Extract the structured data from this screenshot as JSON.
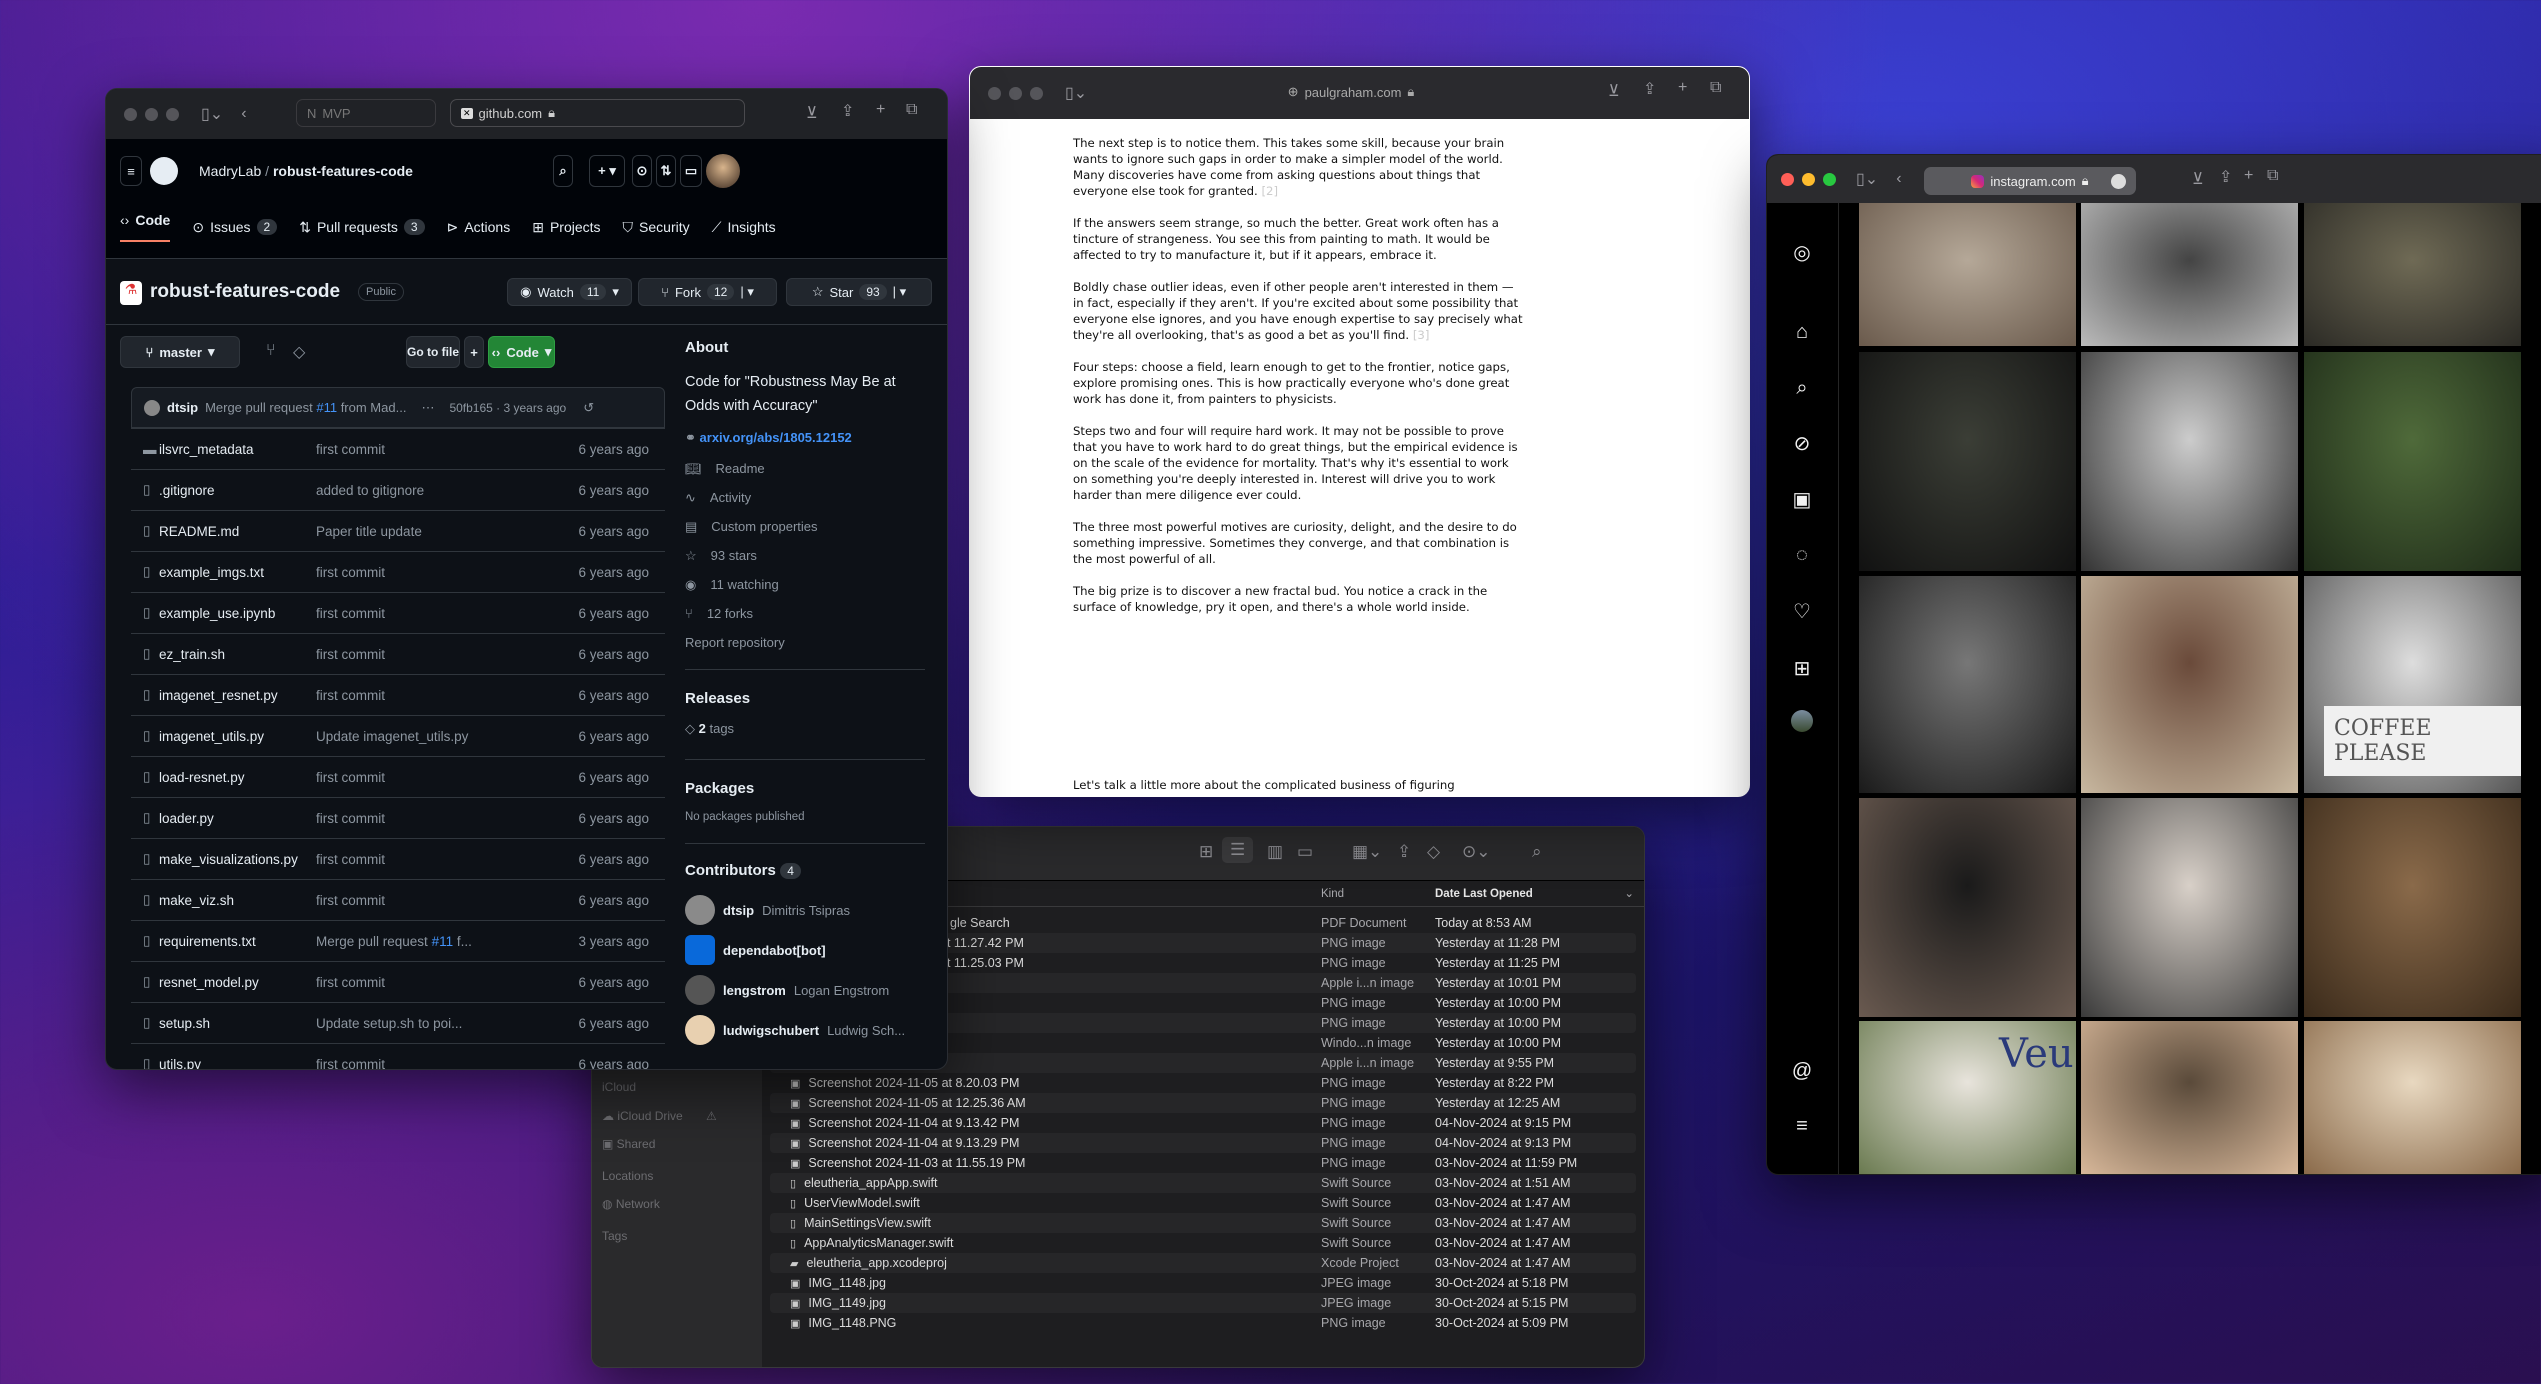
{
  "github_window": {
    "tabs_bar": {
      "pinned_tab": "MVP",
      "url": "github.com"
    },
    "header": {
      "org": "MadryLab",
      "repo": "robust-features-code"
    },
    "nav": [
      {
        "label": "Code"
      },
      {
        "label": "Issues",
        "count": "2"
      },
      {
        "label": "Pull requests",
        "count": "3"
      },
      {
        "label": "Actions"
      },
      {
        "label": "Projects"
      },
      {
        "label": "Security"
      },
      {
        "label": "Insights"
      }
    ],
    "repo_title": "robust-features-code",
    "visibility": "Public",
    "watch": {
      "label": "Watch",
      "count": "11"
    },
    "fork": {
      "label": "Fork",
      "count": "12"
    },
    "star": {
      "label": "Star",
      "count": "93"
    },
    "branch": "master",
    "go_to_file": "Go to file",
    "code_button": "Code",
    "latest_commit": {
      "author": "dtsip",
      "message_pre": "Merge pull request ",
      "pr": "#11",
      "message_post": " from Mad...",
      "sha_time": "50fb165 · 3 years ago"
    },
    "files": [
      {
        "name": "ilsvrc_metadata",
        "type": "folder",
        "message": "first commit",
        "time": "6 years ago"
      },
      {
        "name": ".gitignore",
        "type": "file",
        "message": "added to gitignore",
        "time": "6 years ago"
      },
      {
        "name": "README.md",
        "type": "file",
        "message": "Paper title update",
        "time": "6 years ago"
      },
      {
        "name": "example_imgs.txt",
        "type": "file",
        "message": "first commit",
        "time": "6 years ago"
      },
      {
        "name": "example_use.ipynb",
        "type": "file",
        "message": "first commit",
        "time": "6 years ago"
      },
      {
        "name": "ez_train.sh",
        "type": "file",
        "message": "first commit",
        "time": "6 years ago"
      },
      {
        "name": "imagenet_resnet.py",
        "type": "file",
        "message": "first commit",
        "time": "6 years ago"
      },
      {
        "name": "imagenet_utils.py",
        "type": "file",
        "message": "Update imagenet_utils.py",
        "time": "6 years ago"
      },
      {
        "name": "load-resnet.py",
        "type": "file",
        "message": "first commit",
        "time": "6 years ago"
      },
      {
        "name": "loader.py",
        "type": "file",
        "message": "first commit",
        "time": "6 years ago"
      },
      {
        "name": "make_visualizations.py",
        "type": "file",
        "message": "first commit",
        "time": "6 years ago"
      },
      {
        "name": "make_viz.sh",
        "type": "file",
        "message": "first commit",
        "time": "6 years ago"
      },
      {
        "name": "requirements.txt",
        "type": "file",
        "message": "Merge pull request #11 f...",
        "time": "3 years ago"
      },
      {
        "name": "resnet_model.py",
        "type": "file",
        "message": "first commit",
        "time": "6 years ago"
      },
      {
        "name": "setup.sh",
        "type": "file",
        "message": "Update setup.sh to poi...",
        "time": "6 years ago"
      },
      {
        "name": "utils.py",
        "type": "file",
        "message": "first commit",
        "time": "6 years ago"
      }
    ],
    "about": {
      "heading": "About",
      "description": "Code for \"Robustness May Be at Odds with Accuracy\"",
      "link": "arxiv.org/abs/1805.12152",
      "items": [
        "Readme",
        "Activity",
        "Custom properties",
        "93 stars",
        "11 watching",
        "12 forks"
      ],
      "report": "Report repository"
    },
    "releases": {
      "heading": "Releases",
      "count": "2",
      "label": "tags"
    },
    "packages": {
      "heading": "Packages",
      "text": "No packages published"
    },
    "contributors": {
      "heading": "Contributors",
      "count": "4",
      "list": [
        {
          "login": "dtsip",
          "name": "Dimitris Tsipras"
        },
        {
          "login": "dependabot[bot]",
          "name": ""
        },
        {
          "login": "lengstrom",
          "name": "Logan Engstrom"
        },
        {
          "login": "ludwigschubert",
          "name": "Ludwig Sch..."
        }
      ]
    }
  },
  "paulgraham_window": {
    "url": "paulgraham.com",
    "paragraphs": [
      {
        "text": "The next step is to notice them. This takes some skill, because your brain wants to ignore such gaps in order to make a simpler model of the world. Many discoveries have come from asking questions about things that everyone else took for granted.",
        "note": "[2]"
      },
      {
        "text": "If the answers seem strange, so much the better. Great work often has a tincture of strangeness. You see this from painting to math. It would be affected to try to manufacture it, but if it appears, embrace it.",
        "note": ""
      },
      {
        "text": "Boldly chase outlier ideas, even if other people aren't interested in them — in fact, especially if they aren't. If you're excited about some possibility that everyone else ignores, and you have enough expertise to say precisely what they're all overlooking, that's as good a bet as you'll find.",
        "note": "[3]"
      },
      {
        "text": "Four steps: choose a field, learn enough to get to the frontier, notice gaps, explore promising ones. This is how practically everyone who's done great work has done it, from painters to physicists.",
        "note": ""
      },
      {
        "text": "Steps two and four will require hard work. It may not be possible to prove that you have to work hard to do great things, but the empirical evidence is on the scale of the evidence for mortality. That's why it's essential to work on something you're deeply interested in. Interest will drive you to work harder than mere diligence ever could.",
        "note": ""
      },
      {
        "text": "The three most powerful motives are curiosity, delight, and the desire to do something impressive. Sometimes they converge, and that combination is the most powerful of all.",
        "note": ""
      },
      {
        "text": "The big prize is to discover a new fractal bud. You notice a crack in the surface of knowledge, pry it open, and there's a whole world inside.",
        "note": ""
      }
    ],
    "trailing": "Let's talk a little more about the complicated business of figuring"
  },
  "finder_window": {
    "sidebar": {
      "icloud": "iCloud",
      "icloud_drive": "iCloud Drive",
      "shared": "Shared",
      "locations": "Locations",
      "network": "Network",
      "tags": "Tags"
    },
    "columns": {
      "kind": "Kind",
      "date": "Date Last Opened"
    },
    "rows": [
      {
        "name": "gle Search",
        "kind": "PDF Document",
        "date": "Today at 8:53 AM",
        "partial": true
      },
      {
        "name": "at 11.27.42 PM",
        "kind": "PNG image",
        "date": "Yesterday at 11:28 PM",
        "partial": true
      },
      {
        "name": "at 11.25.03 PM",
        "kind": "PNG image",
        "date": "Yesterday at 11:25 PM",
        "partial": true
      },
      {
        "name": "",
        "kind": "Apple i...n image",
        "date": "Yesterday at 10:01 PM"
      },
      {
        "name": "",
        "kind": "PNG image",
        "date": "Yesterday at 10:00 PM"
      },
      {
        "name": "",
        "kind": "PNG image",
        "date": "Yesterday at 10:00 PM"
      },
      {
        "name": "",
        "kind": "Windo...n image",
        "date": "Yesterday at 10:00 PM"
      },
      {
        "name": "",
        "kind": "Apple i...n image",
        "date": "Yesterday at 9:55 PM"
      },
      {
        "name": "Screenshot 2024-11-05 at 8.20.03 PM",
        "kind": "PNG image",
        "date": "Yesterday at 8:22 PM"
      },
      {
        "name": "Screenshot 2024-11-05 at 12.25.36 AM",
        "kind": "PNG image",
        "date": "Yesterday at 12:25 AM"
      },
      {
        "name": "Screenshot 2024-11-04 at 9.13.42 PM",
        "kind": "PNG image",
        "date": "04-Nov-2024 at 9:15 PM"
      },
      {
        "name": "Screenshot 2024-11-04 at 9.13.29 PM",
        "kind": "PNG image",
        "date": "04-Nov-2024 at 9:13 PM"
      },
      {
        "name": "Screenshot 2024-11-03 at 11.55.19 PM",
        "kind": "PNG image",
        "date": "03-Nov-2024 at 11:59 PM"
      },
      {
        "name": "eleutheria_appApp.swift",
        "kind": "Swift Source",
        "date": "03-Nov-2024 at 1:51 AM"
      },
      {
        "name": "UserViewModel.swift",
        "kind": "Swift Source",
        "date": "03-Nov-2024 at 1:47 AM"
      },
      {
        "name": "MainSettingsView.swift",
        "kind": "Swift Source",
        "date": "03-Nov-2024 at 1:47 AM"
      },
      {
        "name": "AppAnalyticsManager.swift",
        "kind": "Swift Source",
        "date": "03-Nov-2024 at 1:47 AM"
      },
      {
        "name": "eleutheria_app.xcodeproj",
        "kind": "Xcode Project",
        "date": "03-Nov-2024 at 1:47 AM"
      },
      {
        "name": "IMG_1148.jpg",
        "kind": "JPEG image",
        "date": "30-Oct-2024 at 5:18 PM"
      },
      {
        "name": "IMG_1149.jpg",
        "kind": "JPEG image",
        "date": "30-Oct-2024 at 5:15 PM"
      },
      {
        "name": "IMG_1148.PNG",
        "kind": "PNG image",
        "date": "30-Oct-2024 at 5:09 PM"
      }
    ]
  },
  "instagram_window": {
    "url": "instagram.com",
    "sidebar_icons": [
      "instagram-icon",
      "home-icon",
      "search-icon",
      "explore-icon",
      "reels-icon",
      "messenger-icon",
      "heart-icon",
      "create-icon",
      "profile-avatar",
      "threads-icon",
      "menu-icon"
    ],
    "photo_lettering": {
      "coffee": "COFFEE PLEASE",
      "veu": "Veu"
    }
  },
  "colors": {
    "gh_green": "#238636",
    "gh_link": "#4493f8",
    "gh_accent_underline": "#f78166",
    "ig_red": "#ff5f57",
    "ig_yellow": "#febc2e",
    "ig_green": "#28c840"
  }
}
